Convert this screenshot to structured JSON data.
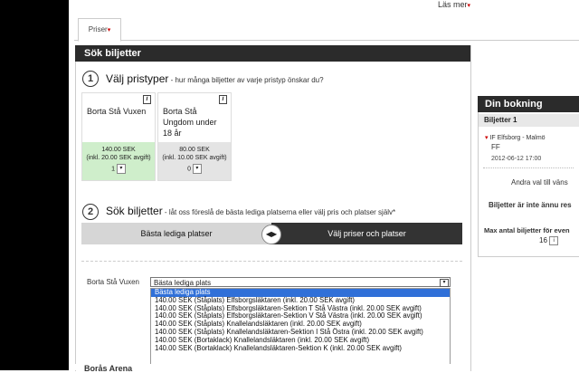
{
  "header": {
    "lasmer": "Läs mer",
    "caret": "▾"
  },
  "tabs": {
    "priser": "Priser"
  },
  "panel": {
    "title": "Sök biljetter"
  },
  "step1": {
    "num": "1",
    "title": "Välj pristyper",
    "subtitle": " - hur många biljetter av varje pristyp önskar du?",
    "cards": [
      {
        "name": "Borta Stå Vuxen",
        "info": "i",
        "price": "140.00 SEK",
        "fee": "(inkl. 20.00 SEK avgift)",
        "qty": "1",
        "arrow": "▾"
      },
      {
        "name": "Borta Stå Ungdom under 18 år",
        "info": "i",
        "price": "80.00 SEK",
        "fee": "(inkl. 10.00 SEK avgift)",
        "qty": "0",
        "arrow": "▾"
      }
    ]
  },
  "step2": {
    "num": "2",
    "title": "Sök biljetter",
    "subtitle": " - låt oss föreslå de bästa lediga platserna eller välj pris och platser själv*",
    "left_label": "Bästa lediga platser",
    "right_label": "Välj priser och platser",
    "toggle": "◀▶"
  },
  "selection": {
    "row_label": "Borta Stå Vuxen",
    "selected_value": "Bästa lediga plats",
    "arrow": "▾",
    "options": [
      "Bästa lediga plats",
      "140.00 SEK (Ståplats) Elfsborgsläktaren (inkl. 20.00 SEK avgift)",
      "140.00 SEK (Ståplats) Elfsborgsläktaren-Sektion T Stå Västra (inkl. 20.00 SEK avgift)",
      "140.00 SEK (Ståplats) Elfsborgsläktaren-Sektion V Stå Västra (inkl. 20.00 SEK avgift)",
      "140.00 SEK (Ståplats) Knallelandsläktaren (inkl. 20.00 SEK avgift)",
      "140.00 SEK (Ståplats) Knallelandsläktaren-Sektion I Stå Östra (inkl. 20.00 SEK avgift)",
      "140.00 SEK (Bortaklack) Knallelandsläktaren (inkl. 20.00 SEK avgift)",
      "140.00 SEK (Bortaklack) Knallelandsläktaren-Sektion K (inkl. 20.00 SEK avgift)"
    ]
  },
  "bottom": {
    "text": "Borås Arena"
  },
  "sidebar": {
    "title": "Din bokning",
    "subtitle": "Biljetter 1",
    "match": "IF Elfsborg - Malmö",
    "match2": "FF",
    "date": "2012-06-12 17:00",
    "line1": "Andra val till väns",
    "line2": "Biljetter är inte ännu res",
    "line3": "Max antal biljetter för even",
    "qty": "16",
    "info": "i"
  }
}
